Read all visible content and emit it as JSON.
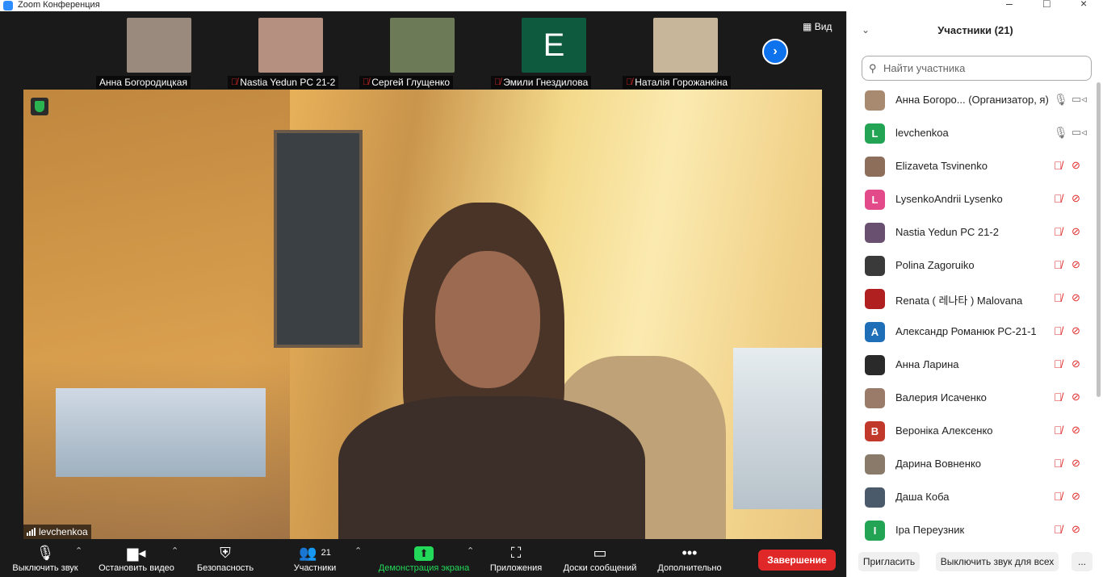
{
  "window": {
    "title": "Zoom Конференция",
    "controls": [
      "–",
      "□",
      "×"
    ]
  },
  "thumbnails": [
    {
      "name": "Анна Богородицкая",
      "muted": false,
      "color": "#9a8a7e"
    },
    {
      "name": "Nastia Yedun PC 21-2",
      "muted": true,
      "color": "#b59080"
    },
    {
      "name": "Сергей Глущенко",
      "muted": true,
      "color": "#6c7a58"
    },
    {
      "name": "Эмили Гнездилова",
      "muted": true,
      "letter": "E",
      "color": "#0e5a3f"
    },
    {
      "name": "Наталія Горожанкіна",
      "muted": true,
      "color": "#c7b69a"
    }
  ],
  "view_label": "Вид",
  "main_speaker": {
    "name": "levchenkoa"
  },
  "toolbar": {
    "mute": "Выключить звук",
    "video": "Остановить видео",
    "security": "Безопасность",
    "participants": "Участники",
    "participants_count": "21",
    "share": "Демонстрация экрана",
    "apps": "Приложения",
    "whiteboards": "Доски сообщений",
    "more": "Дополнительно",
    "end": "Завершение"
  },
  "panel": {
    "title": "Участники (21)",
    "search_placeholder": "Найти участника",
    "participants": [
      {
        "name": "Анна Богоро... (Организатор, я)",
        "avatar": "",
        "color": "#a88a70",
        "audio": "on",
        "video": "on"
      },
      {
        "name": "levchenkoa",
        "avatar": "L",
        "color": "#23a455",
        "audio": "on",
        "video": "on"
      },
      {
        "name": "Elizaveta Tsvinenko",
        "avatar": "",
        "color": "#8c6e5a",
        "audio": "off",
        "video": "off"
      },
      {
        "name": "LysenkoAndrii Lysenko",
        "avatar": "L",
        "color": "#e24a8a",
        "audio": "off",
        "video": "off"
      },
      {
        "name": "Nastia Yedun PC 21-2",
        "avatar": "",
        "color": "#6a5070",
        "audio": "off",
        "video": "off"
      },
      {
        "name": "Polina Zagoruiko",
        "avatar": "",
        "color": "#3a3a3a",
        "audio": "off",
        "video": "off"
      },
      {
        "name": "Renata ( 레나타 ) Malovana",
        "avatar": "",
        "color": "#b02020",
        "audio": "off",
        "video": "off"
      },
      {
        "name": "Александр Романюк РС-21-1",
        "avatar": "A",
        "color": "#1e6fb8",
        "audio": "off",
        "video": "off"
      },
      {
        "name": "Анна Ларина",
        "avatar": "",
        "color": "#2a2a2a",
        "audio": "off",
        "video": "off"
      },
      {
        "name": "Валерия Исаченко",
        "avatar": "",
        "color": "#9a7a68",
        "audio": "off",
        "video": "off"
      },
      {
        "name": "Вероніка Алексенко",
        "avatar": "B",
        "color": "#c0392b",
        "audio": "off",
        "video": "off"
      },
      {
        "name": "Дарина Вовненко",
        "avatar": "",
        "color": "#8a7a6a",
        "audio": "off",
        "video": "off"
      },
      {
        "name": "Даша Коба",
        "avatar": "",
        "color": "#4a5a6a",
        "audio": "off",
        "video": "off"
      },
      {
        "name": "Іра Переузник",
        "avatar": "I",
        "color": "#23a455",
        "audio": "off",
        "video": "off"
      }
    ],
    "invite": "Пригласить",
    "mute_all": "Выключить звук для всех",
    "more": "..."
  }
}
